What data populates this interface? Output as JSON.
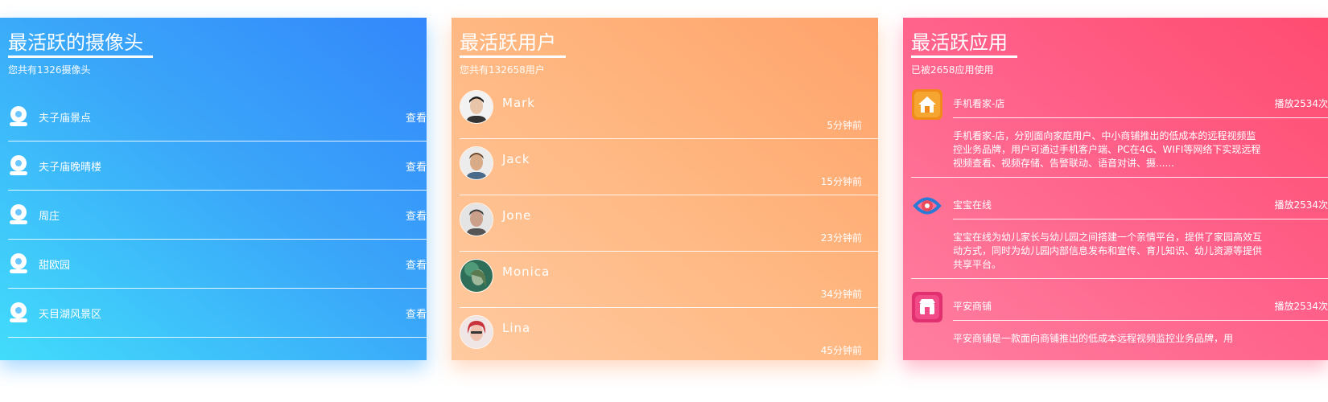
{
  "cameras_panel": {
    "title": "最活跃的摄像头",
    "subtitle": "您共有1326摄像头",
    "items": [
      {
        "name": "夫子庙景点",
        "action": "查看"
      },
      {
        "name": "夫子庙晚晴楼",
        "action": "查看"
      },
      {
        "name": "周庄",
        "action": "查看"
      },
      {
        "name": "甜欧园",
        "action": "查看"
      },
      {
        "name": "天目湖风景区",
        "action": "查看"
      }
    ],
    "icon": "webcam-icon",
    "colors": {
      "from": "#42dcfb",
      "to": "#3387fb"
    }
  },
  "users_panel": {
    "title": "最活跃用户",
    "subtitle": "您共有132658用户",
    "items": [
      {
        "name": "Mark",
        "time": "5分钟前"
      },
      {
        "name": "Jack",
        "time": "15分钟前"
      },
      {
        "name": "Jone",
        "time": "23分钟前"
      },
      {
        "name": "Monica",
        "time": "34分钟前"
      },
      {
        "name": "Lina",
        "time": "45分钟前"
      }
    ],
    "colors": {
      "from": "#ffcaa0",
      "to": "#ffa26b"
    }
  },
  "apps_panel": {
    "title": "最活跃应用",
    "subtitle": "已被2658应用使用",
    "items": [
      {
        "name": "手机看家-店",
        "plays": "播放2534次",
        "desc": "手机看家-店，分别面向家庭用户、中小商铺推出的低成本的远程视频监控业务品牌，用户可通过手机客户端、PC在4G、WIFI等网络下实现远程视频查看、视频存储、告警联动、语音对讲、摄......",
        "icon": "home-app-icon"
      },
      {
        "name": "宝宝在线",
        "plays": "播放2534次",
        "desc": "宝宝在线为幼儿家长与幼儿园之间搭建一个亲情平台，提供了家园高效互动方式，同时为幼儿园内部信息发布和宣传、育儿知识、幼儿资源等提供共享平台。",
        "icon": "baby-online-app-icon"
      },
      {
        "name": "平安商铺",
        "plays": "播放2534次",
        "desc": "平安商铺是一款面向商铺推出的低成本远程视频监控业务品牌，用",
        "icon": "shop-app-icon"
      }
    ],
    "colors": {
      "from": "#ff7fa0",
      "to": "#ff4c70"
    }
  }
}
